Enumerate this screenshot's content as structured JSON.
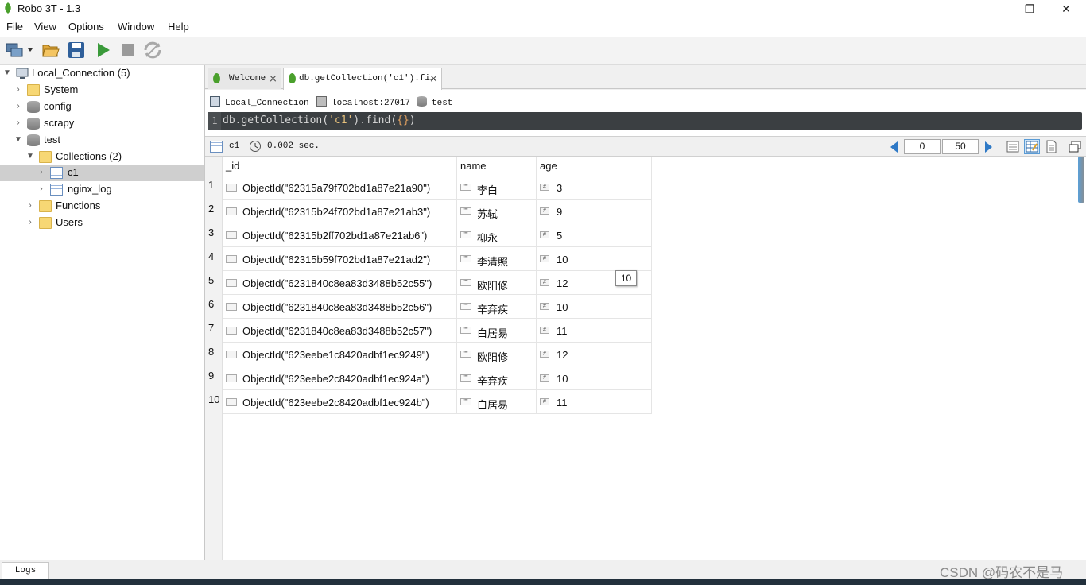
{
  "window": {
    "title": "Robo 3T - 1.3",
    "controls": {
      "minimize": "—",
      "maximize": "❐",
      "close": "✕"
    }
  },
  "menu": [
    "File",
    "View",
    "Options",
    "Window",
    "Help"
  ],
  "toolbar": {
    "buttons": [
      "connect-icon",
      "open-icon",
      "save-icon",
      "execute-icon",
      "stop-icon",
      "orient-icon"
    ]
  },
  "sidebar": {
    "items": [
      {
        "label": "Local_Connection (5)",
        "icon": "computer-icon"
      },
      {
        "label": "System",
        "icon": "folder-icon"
      },
      {
        "label": "config",
        "icon": "database-icon"
      },
      {
        "label": "scrapy",
        "icon": "database-icon"
      },
      {
        "label": "test",
        "icon": "database-icon"
      },
      {
        "label": "Collections (2)",
        "icon": "folder-icon"
      },
      {
        "label": "c1",
        "icon": "collection-icon"
      },
      {
        "label": "nginx_log",
        "icon": "collection-icon"
      },
      {
        "label": "Functions",
        "icon": "folder-icon"
      },
      {
        "label": "Users",
        "icon": "folder-icon"
      }
    ]
  },
  "tabs": [
    {
      "label": "Welcome"
    },
    {
      "label": "db.getCollection('c1').fi…"
    }
  ],
  "connection": {
    "name": "Local_Connection",
    "host": "localhost:27017",
    "database": "test"
  },
  "editor": {
    "line_number": "1",
    "code_prefix": "db.getCollection(",
    "code_string": "'c1'",
    "code_mid": ").find(",
    "code_braces": "{}",
    "code_suffix": ")"
  },
  "result": {
    "collection": "c1",
    "time": "0.002 sec.",
    "skip": "0",
    "limit": "50"
  },
  "table": {
    "columns": [
      "_id",
      "name",
      "age"
    ],
    "rows": [
      {
        "num": "1",
        "id": "ObjectId(\"62315a79f702bd1a87e21a90\")",
        "name": "李白",
        "age": "3"
      },
      {
        "num": "2",
        "id": "ObjectId(\"62315b24f702bd1a87e21ab3\")",
        "name": "苏轼",
        "age": "9"
      },
      {
        "num": "3",
        "id": "ObjectId(\"62315b2ff702bd1a87e21ab6\")",
        "name": "柳永",
        "age": "5"
      },
      {
        "num": "4",
        "id": "ObjectId(\"62315b59f702bd1a87e21ad2\")",
        "name": "李清照",
        "age": "10"
      },
      {
        "num": "5",
        "id": "ObjectId(\"6231840c8ea83d3488b52c55\")",
        "name": "欧阳修",
        "age": "12"
      },
      {
        "num": "6",
        "id": "ObjectId(\"6231840c8ea83d3488b52c56\")",
        "name": "辛弃疾",
        "age": "10"
      },
      {
        "num": "7",
        "id": "ObjectId(\"6231840c8ea83d3488b52c57\")",
        "name": "白居易",
        "age": "11"
      },
      {
        "num": "8",
        "id": "ObjectId(\"623eebe1c8420adbf1ec9249\")",
        "name": "欧阳修",
        "age": "12"
      },
      {
        "num": "9",
        "id": "ObjectId(\"623eebe2c8420adbf1ec924a\")",
        "name": "辛弃疾",
        "age": "10"
      },
      {
        "num": "10",
        "id": "ObjectId(\"623eebe2c8420adbf1ec924b\")",
        "name": "白居易",
        "age": "11"
      }
    ],
    "tooltip": "10",
    "type_markers": {
      "string": "\"\"",
      "number": "#"
    }
  },
  "logs_tab": "Logs",
  "watermark": "CSDN @码农不是马",
  "colors": {
    "accent": "#4aa02c",
    "selection": "#cfcfcf",
    "editor_bg": "#3b3f42"
  }
}
